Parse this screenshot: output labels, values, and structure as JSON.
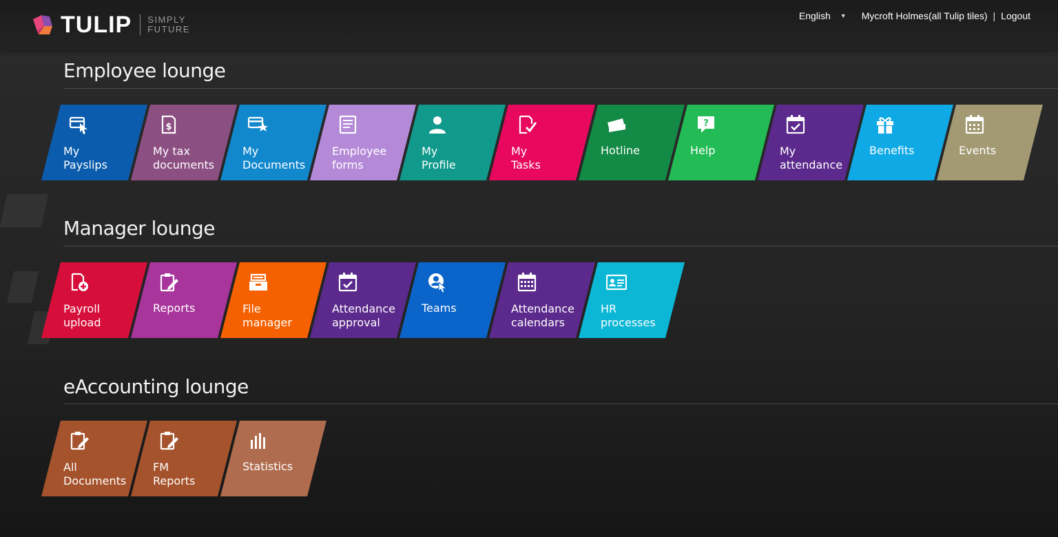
{
  "header": {
    "brand": "TULIP",
    "tagline_1": "SIMPLY",
    "tagline_2": "FUTURE",
    "language": "English",
    "user": "Mycroft Holmes(all Tulip tiles)",
    "separator": "|",
    "logout": "Logout"
  },
  "sections": [
    {
      "title": "Employee lounge",
      "tiles": [
        {
          "label": "My\nPayslips",
          "icon": "payslip-card-icon",
          "color": "#0b5cad"
        },
        {
          "label": "My tax\ndocuments",
          "icon": "tax-document-icon",
          "color": "#8c4f82"
        },
        {
          "label": "My\nDocuments",
          "icon": "document-star-icon",
          "color": "#1188cc"
        },
        {
          "label": "Employee\nforms",
          "icon": "form-icon",
          "color": "#b48ad8"
        },
        {
          "label": "My\nProfile",
          "icon": "person-icon",
          "color": "#119a8c"
        },
        {
          "label": "My\nTasks",
          "icon": "task-check-icon",
          "color": "#e8085e"
        },
        {
          "label": "Hotline",
          "icon": "ticket-icon",
          "color": "#138a45"
        },
        {
          "label": "Help",
          "icon": "help-bubble-icon",
          "color": "#23bb55"
        },
        {
          "label": "My\nattendance",
          "icon": "calendar-check-icon",
          "color": "#5b2a8c"
        },
        {
          "label": "Benefits",
          "icon": "gift-icon",
          "color": "#0fa9e6"
        },
        {
          "label": "Events",
          "icon": "calendar-icon",
          "color": "#a39a74"
        }
      ]
    },
    {
      "title": "Manager lounge",
      "tiles": [
        {
          "label": "Payroll\nupload",
          "icon": "file-add-icon",
          "color": "#d50f3a"
        },
        {
          "label": "Reports",
          "icon": "clipboard-edit-icon",
          "color": "#a7359c"
        },
        {
          "label": "File\nmanager",
          "icon": "file-drawer-icon",
          "color": "#f56100"
        },
        {
          "label": "Attendance\napproval",
          "icon": "calendar-check-icon",
          "color": "#5b2a8c"
        },
        {
          "label": "Teams",
          "icon": "team-pointer-icon",
          "color": "#0b64c9"
        },
        {
          "label": "Attendance\ncalendars",
          "icon": "calendar-grid-icon",
          "color": "#5b2a8c"
        },
        {
          "label": "HR\nprocesses",
          "icon": "id-card-icon",
          "color": "#0bb7d5"
        }
      ]
    },
    {
      "title": "eAccounting lounge",
      "tiles": [
        {
          "label": "All\nDocuments",
          "icon": "clipboard-edit-icon",
          "color": "#a5532c"
        },
        {
          "label": "FM\nReports",
          "icon": "clipboard-edit-icon",
          "color": "#a5532c"
        },
        {
          "label": "Statistics",
          "icon": "bar-chart-icon",
          "color": "#b06c4e"
        }
      ]
    }
  ]
}
